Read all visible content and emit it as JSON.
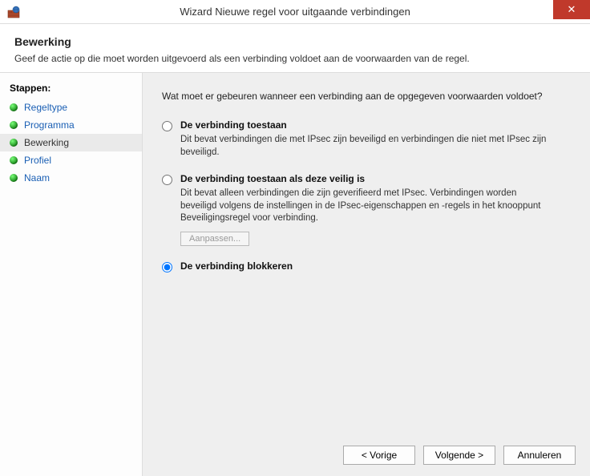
{
  "window": {
    "title": "Wizard Nieuwe regel voor uitgaande verbindingen"
  },
  "header": {
    "heading": "Bewerking",
    "subtitle": "Geef de actie op die moet worden uitgevoerd als een verbinding voldoet aan de voorwaarden van de regel."
  },
  "sidebar": {
    "title": "Stappen:",
    "items": [
      {
        "label": "Regeltype",
        "current": false
      },
      {
        "label": "Programma",
        "current": false
      },
      {
        "label": "Bewerking",
        "current": true
      },
      {
        "label": "Profiel",
        "current": false
      },
      {
        "label": "Naam",
        "current": false
      }
    ]
  },
  "main": {
    "question": "Wat moet er gebeuren wanneer een verbinding aan de opgegeven voorwaarden voldoet?",
    "options": [
      {
        "value": "allow",
        "selected": false,
        "title": "De verbinding toestaan",
        "desc": "Dit bevat verbindingen die met IPsec zijn beveiligd en verbindingen die niet met IPsec zijn beveiligd."
      },
      {
        "value": "allow_secure",
        "selected": false,
        "title": "De verbinding toestaan als deze veilig is",
        "desc": "Dit bevat alleen verbindingen die zijn geverifieerd met IPsec. Verbindingen worden beveiligd volgens de instellingen in de IPsec-eigenschappen en -regels in het knooppunt Beveiligingsregel voor verbinding.",
        "customize_label": "Aanpassen..."
      },
      {
        "value": "block",
        "selected": true,
        "title": "De verbinding blokkeren",
        "desc": ""
      }
    ]
  },
  "footer": {
    "back": "< Vorige",
    "next": "Volgende >",
    "cancel": "Annuleren"
  }
}
